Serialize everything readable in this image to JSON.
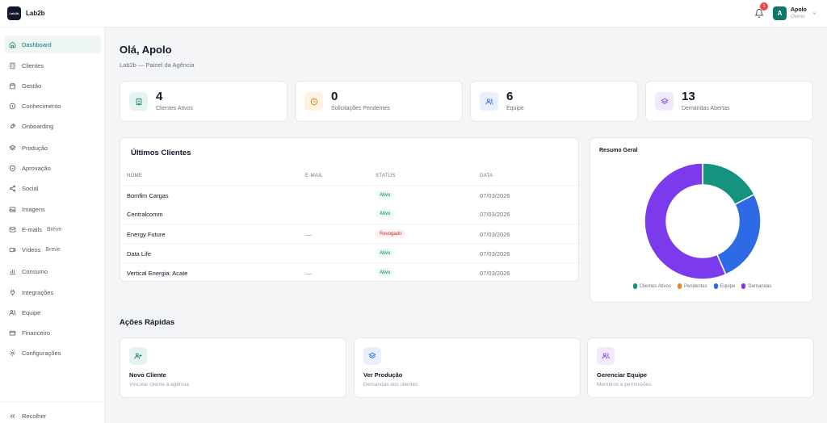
{
  "app": {
    "logo_text": "Lab2b",
    "name": "Lab2b"
  },
  "header": {
    "notification_count": "1",
    "user_initial": "A",
    "user_name": "Apolo",
    "user_role": "Owner"
  },
  "sidebar": {
    "items": [
      {
        "label": "Dashboard",
        "icon": "home-icon",
        "active": true
      },
      {
        "label": "Clientes",
        "icon": "building-icon"
      },
      {
        "label": "Gestão",
        "icon": "calendar-icon"
      },
      {
        "label": "Conhecimento",
        "icon": "info-icon"
      },
      {
        "label": "Onboarding",
        "icon": "rocket-icon"
      },
      {
        "label": "Produção",
        "icon": "layers-icon"
      },
      {
        "label": "Aprovação",
        "icon": "shield-check-icon"
      },
      {
        "label": "Social",
        "icon": "share-icon"
      },
      {
        "label": "Imagens",
        "icon": "image-icon"
      },
      {
        "label": "E-mails",
        "icon": "mail-icon",
        "badge": "Breve"
      },
      {
        "label": "Vídeos",
        "icon": "video-icon",
        "badge": "Breve"
      },
      {
        "label": "Consumo",
        "icon": "bar-chart-icon"
      },
      {
        "label": "Integrações",
        "icon": "plug-icon"
      },
      {
        "label": "Equipe",
        "icon": "users-icon"
      },
      {
        "label": "Financeiro",
        "icon": "wallet-icon"
      },
      {
        "label": "Configurações",
        "icon": "gear-icon"
      }
    ],
    "collapse_label": "Recolher"
  },
  "page": {
    "greeting": "Olá, Apolo",
    "subtitle": "Lab2b — Painel da Agência"
  },
  "stats": [
    {
      "value": "4",
      "label": "Clientes Ativos",
      "icon": "building-icon",
      "color": "#0f766e",
      "bg": "#e6f4f1"
    },
    {
      "value": "0",
      "label": "Solicitações Pendentes",
      "icon": "clock-icon",
      "color": "#d97706",
      "bg": "#fef3e2"
    },
    {
      "value": "6",
      "label": "Equipe",
      "icon": "users-icon",
      "color": "#2563eb",
      "bg": "#e8effd"
    },
    {
      "value": "13",
      "label": "Demandas Abertas",
      "icon": "layers-icon",
      "color": "#7c3aed",
      "bg": "#f1eafd"
    }
  ],
  "clients_table": {
    "title": "Últimos Clientes",
    "columns": [
      "NOME",
      "E-MAIL",
      "STATUS",
      "DATA"
    ],
    "rows": [
      {
        "name": "Bomfim Cargas",
        "email": "",
        "status": "Ativo",
        "status_kind": "ok",
        "date": "07/03/2026"
      },
      {
        "name": "Centralcomm",
        "email": "",
        "status": "Ativo",
        "status_kind": "ok",
        "date": "07/03/2026"
      },
      {
        "name": "Energy Future",
        "email": "—",
        "status": "Revogado",
        "status_kind": "bad",
        "date": "07/03/2026"
      },
      {
        "name": "Data Life",
        "email": "",
        "status": "Ativo",
        "status_kind": "ok",
        "date": "07/03/2026"
      },
      {
        "name": "Vertical Energia: Acate",
        "email": "—",
        "status": "Ativo",
        "status_kind": "ok",
        "date": "07/03/2026"
      }
    ]
  },
  "chart_data": {
    "type": "pie",
    "title": "Resumo Geral",
    "categories": [
      "Clientes Ativos",
      "Pendentes",
      "Equipe",
      "Demandas"
    ],
    "values": [
      4,
      0,
      6,
      13
    ],
    "colors": [
      "#14937f",
      "#e8872e",
      "#2f6ae6",
      "#7c3aed"
    ],
    "legend": "bottom"
  },
  "quick_actions": {
    "title": "Ações Rápidas",
    "items": [
      {
        "title": "Novo Cliente",
        "desc": "Vincular cliente à agência",
        "icon": "user-plus-icon",
        "color": "#0f766e",
        "bg": "#e6f4f1"
      },
      {
        "title": "Ver Produção",
        "desc": "Demandas dos clientes",
        "icon": "layers-icon",
        "color": "#2563eb",
        "bg": "#e8effd"
      },
      {
        "title": "Gerenciar Equipe",
        "desc": "Membros e permissões",
        "icon": "users-icon",
        "color": "#7c3aed",
        "bg": "#f1eafd"
      }
    ]
  }
}
